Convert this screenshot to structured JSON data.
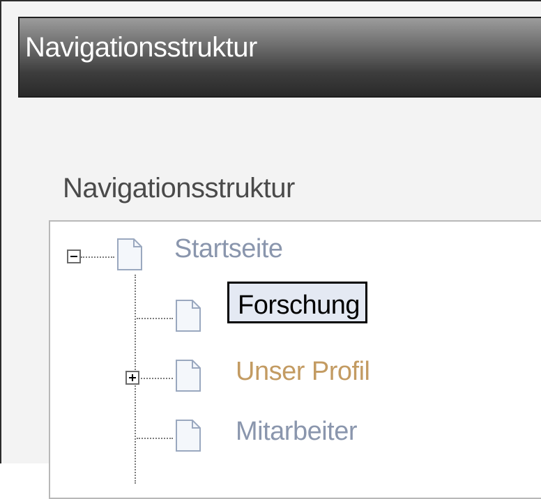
{
  "window": {
    "title": "Navigationsstruktur"
  },
  "section": {
    "label": "Navigationsstruktur"
  },
  "tree": {
    "nodes": [
      {
        "label": "Startseite",
        "expander": "minus",
        "icon": "page-icon",
        "selected": false
      },
      {
        "label": "Forschung",
        "expander": null,
        "icon": "page-icon",
        "selected": true
      },
      {
        "label": "Unser Profil",
        "expander": "plus",
        "icon": "page-icon",
        "selected": false
      },
      {
        "label": "Mitarbeiter",
        "expander": null,
        "icon": "page-icon",
        "selected": false
      }
    ]
  },
  "colors": {
    "title_bar_dark": "#2a2a2a",
    "node_text_muted": "#8a96ad",
    "node_text_orange": "#c39b62",
    "selection_fill": "#e4e9f3"
  }
}
